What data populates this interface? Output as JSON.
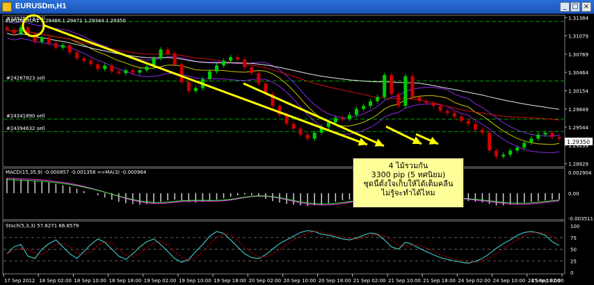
{
  "window": {
    "title": "EURUSDm,H1",
    "minimize_glyph": "_",
    "maximize_glyph": "□",
    "close_glyph": "×"
  },
  "price_panel": {
    "symbol_ohlc": "EURUSDm,H1  1.29466 1.29471 1.29344 1.29350",
    "current_price": "1.29350",
    "order_labels": [
      {
        "text": "#23925613 sell",
        "price": 1.3132
      },
      {
        "text": "#24267823 sell",
        "price": 1.3032
      },
      {
        "text": "#24341890 sell",
        "price": 1.2968
      },
      {
        "text": "#24394632 sell",
        "price": 1.2947
      }
    ],
    "price_ticks": [
      "1.31384",
      "1.31079",
      "1.30769",
      "1.30464",
      "1.30154",
      "1.29849",
      "1.29544",
      "1.29239",
      "1.28929"
    ]
  },
  "macd_panel": {
    "label": "MACD(15,35,9) -0.000857 -0.001358  =>MA(3) -0.000964",
    "ticks": [
      "0.002904",
      "0.00",
      "-0.003511"
    ]
  },
  "stoch_panel": {
    "label": "Stoch(5,3,3) 57.6271 66.8579",
    "ticks": [
      "100",
      "75",
      "50",
      "25",
      "0"
    ]
  },
  "time_axis": [
    "17 Sep 2012",
    "18 Sep 02:00",
    "18 Sep 10:00",
    "18 Sep 18:00",
    "19 Sep 02:00",
    "19 Sep 10:00",
    "19 Sep 18:00",
    "20 Sep 02:00",
    "20 Sep 10:00",
    "20 Sep 18:00",
    "21 Sep 02:00",
    "21 Sep 10:00",
    "21 Sep 18:00",
    "24 Sep 02:00",
    "24 Sep 10:00",
    "24 Sep 18:00",
    "25 Sep 02:00"
  ],
  "callout": {
    "line1": "4 ไม้รวมกัน",
    "line2": "3300 pip (5 ทศนิยม)",
    "line3": "ชุดนี้ตั้งใจเก็บให้ได้เต็มคลื่น",
    "line4": "ไม่รู้จะทำได้ไหม"
  },
  "colors": {
    "background": "#000000",
    "bull_candle": "#00cc00",
    "bear_candle": "#cc0000",
    "bollinger": "#8a2be2",
    "ma_white": "#e8e8e8",
    "ma_red": "#d01010",
    "arrow": "#ffff00",
    "order_line": "#00a000",
    "stoch": "#40c0c0"
  },
  "chart_data": {
    "type": "candlestick",
    "closes": [
      1.3118,
      1.3112,
      1.3122,
      1.311,
      1.3098,
      1.3105,
      1.3095,
      1.3088,
      1.3092,
      1.308,
      1.307,
      1.3066,
      1.306,
      1.3052,
      1.3058,
      1.3048,
      1.3045,
      1.305,
      1.3046,
      1.305,
      1.3056,
      1.307,
      1.3085,
      1.3078,
      1.306,
      1.303,
      1.3015,
      1.302,
      1.3035,
      1.3048,
      1.3058,
      1.3066,
      1.3072,
      1.3068,
      1.3055,
      1.3045,
      1.3028,
      1.301,
      1.299,
      1.2975,
      1.296,
      1.2952,
      1.2942,
      1.2935,
      1.2945,
      1.2955,
      1.2962,
      1.297,
      1.2968,
      1.2975,
      1.2985,
      1.299,
      1.2998,
      1.3005,
      1.3042,
      1.301,
      1.299,
      1.304,
      1.3005,
      1.2998,
      1.2995,
      1.299,
      1.2982,
      1.2978,
      1.2972,
      1.2965,
      1.296,
      1.295,
      1.2945,
      1.2915,
      1.2905,
      1.2908,
      1.2915,
      1.292,
      1.2928,
      1.2935,
      1.2942,
      1.2945,
      1.2938,
      1.2935
    ],
    "stochastic_k": [
      40,
      55,
      60,
      35,
      30,
      50,
      62,
      70,
      55,
      40,
      30,
      45,
      60,
      72,
      65,
      50,
      35,
      28,
      40,
      55,
      66,
      72,
      60,
      45,
      30,
      22,
      28,
      45,
      60,
      78,
      88,
      84,
      70,
      55,
      40,
      32,
      30,
      38,
      50,
      62,
      70,
      78,
      86,
      90,
      88,
      82,
      80,
      76,
      72,
      70,
      74,
      80,
      85,
      82,
      70,
      55,
      50,
      65,
      60,
      52,
      45,
      38,
      32,
      28,
      25,
      22,
      20,
      24,
      30,
      40,
      52,
      62,
      70,
      80,
      86,
      88,
      85,
      80,
      66,
      58
    ],
    "macd_hist": [
      0.0021,
      0.002,
      0.0019,
      0.0018,
      0.0017,
      0.0016,
      0.0015,
      0.0013,
      0.0011,
      0.0009,
      0.0006,
      0.0003,
      0.0,
      -0.0003,
      -0.0006,
      -0.0009,
      -0.0012,
      -0.0014,
      -0.0015,
      -0.0016,
      -0.0015,
      -0.0014,
      -0.0012,
      -0.001,
      -0.0009,
      -0.001,
      -0.0012,
      -0.0013,
      -0.0012,
      -0.0011,
      -0.0009,
      -0.0007,
      -0.0005,
      -0.0003,
      -0.0002,
      -0.0003,
      -0.0005,
      -0.0008,
      -0.0011,
      -0.0013,
      -0.0015,
      -0.0016,
      -0.0017,
      -0.0018,
      -0.0017,
      -0.0016,
      -0.0014,
      -0.0012,
      -0.001,
      -0.0009,
      -0.0007,
      -0.0006,
      -0.0005,
      -0.0004,
      -0.0002,
      -0.0003,
      -0.0004,
      -0.0002,
      -0.0003,
      -0.0004,
      -0.0005,
      -0.0006,
      -0.0007,
      -0.0008,
      -0.0009,
      -0.001,
      -0.0011,
      -0.0012,
      -0.0013,
      -0.0015,
      -0.0017,
      -0.0017,
      -0.0016,
      -0.0015,
      -0.0013,
      -0.0012,
      -0.0011,
      -0.001,
      -0.0009,
      -0.0009
    ]
  }
}
